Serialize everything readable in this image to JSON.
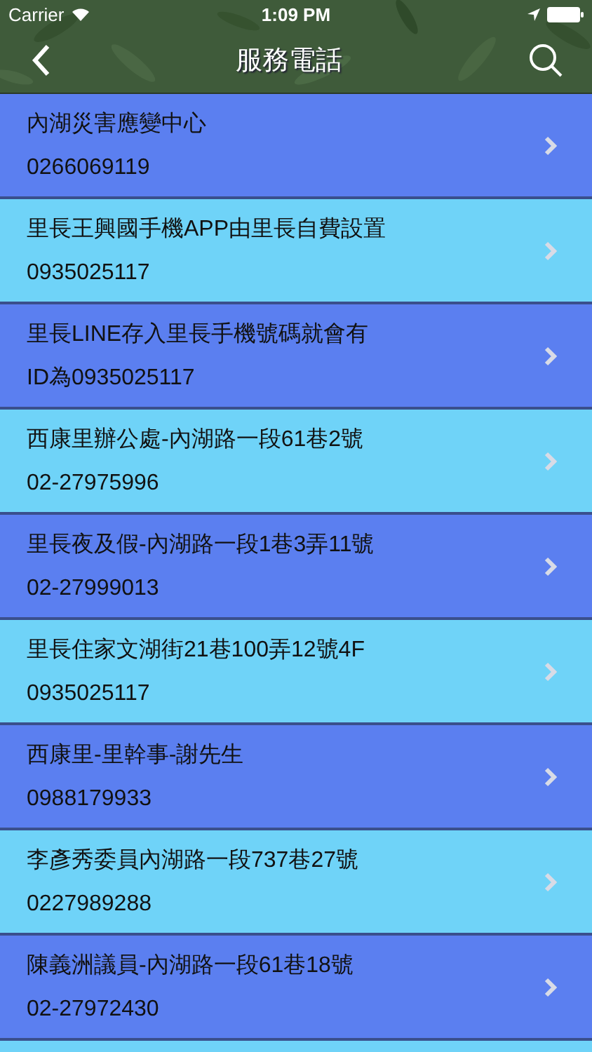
{
  "status_bar": {
    "carrier": "Carrier",
    "time": "1:09 PM"
  },
  "nav": {
    "title": "服務電話"
  },
  "items": [
    {
      "name": "內湖災害應變中心",
      "phone": "0266069119"
    },
    {
      "name": "里長王興國手機APP由里長自費設置",
      "phone": "0935025117"
    },
    {
      "name": "里長LINE存入里長手機號碼就會有",
      "phone": "ID為0935025117"
    },
    {
      "name": "西康里辦公處-內湖路一段61巷2號",
      "phone": "02-27975996"
    },
    {
      "name": "里長夜及假-內湖路一段1巷3弄11號",
      "phone": "02-27999013"
    },
    {
      "name": "里長住家文湖街21巷100弄12號4F",
      "phone": "0935025117"
    },
    {
      "name": "西康里-里幹事-謝先生",
      "phone": "0988179933"
    },
    {
      "name": "李彥秀委員內湖路一段737巷27號",
      "phone": "0227989288"
    },
    {
      "name": "陳義洲議員-內湖路一段61巷18號",
      "phone": "02-27972430"
    }
  ]
}
